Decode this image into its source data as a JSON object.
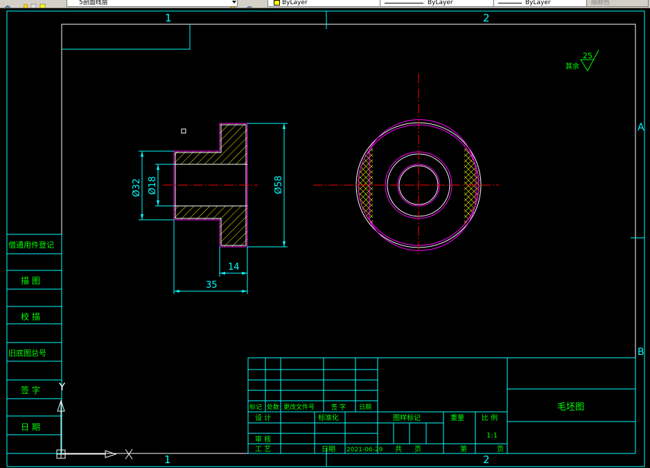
{
  "toolbar": {
    "layer_name": "5剖面线层",
    "color": "ByLayer",
    "linetype": "ByLayer",
    "lineweight": "ByLayer",
    "plotstyle": "随颜色"
  },
  "grid": {
    "col1": "1",
    "col2": "2",
    "rowA": "A",
    "rowB": "B"
  },
  "roughness": {
    "label": "其余",
    "value": "25"
  },
  "dimensions": {
    "d32": "Ø32",
    "d18": "Ø18",
    "d58": "Ø58",
    "len14": "14",
    "len35": "35"
  },
  "side_block": {
    "row1": "借通用件登记",
    "row2": "描 图",
    "row3": "校 描",
    "row4": "旧底图总号",
    "row5": "签 字",
    "row6": "日 期"
  },
  "title_block": {
    "h_mark": "标记",
    "h_count": "处数",
    "h_doc": "更改文件号",
    "h_sign": "签 字",
    "h_date": "日期",
    "design": "设 计",
    "standard": "标准化",
    "review": "审 核",
    "process": "工 艺",
    "date_label": "日期",
    "date_value": "2021-06-29",
    "stage_mark": "图样标记",
    "weight": "重量",
    "scale_label": "比 例",
    "scale_value": "1:1",
    "total": "共",
    "sheet_unit1": "页",
    "page": "第",
    "sheet_unit2": "页",
    "drawing_name": "毛坯图"
  },
  "ucs": {
    "y": "Y",
    "x": "X"
  },
  "colors": {
    "background": "#000000",
    "frame": "#00ffff",
    "text": "#00ff00",
    "center_line": "#ff0000",
    "hatch": "#ffff00",
    "part_outline": "#ff00ff",
    "outline": "#ffffff"
  }
}
